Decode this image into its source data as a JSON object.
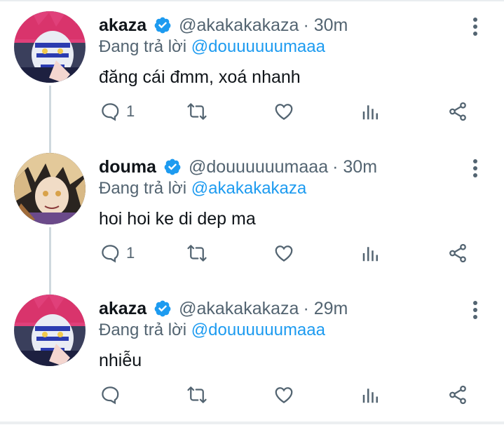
{
  "tweets": [
    {
      "name": "akaza",
      "handle": "@akakakakaza",
      "time": "· 30m",
      "reply_prefix": "Đang trả lời ",
      "reply_to": "@douuuuuumaaa",
      "text": "đăng cái đmm, xoá nhanh",
      "reply_count": "1",
      "avatar": "akaza-avatar"
    },
    {
      "name": "douma",
      "handle": "@douuuuuumaaa",
      "time": "· 30m",
      "reply_prefix": "Đang trả lời ",
      "reply_to": "@akakakakaza",
      "text": "hoi hoi ke di dep ma",
      "reply_count": "1",
      "avatar": "douma-avatar"
    },
    {
      "name": "akaza",
      "handle": "@akakakakaza",
      "time": "· 29m",
      "reply_prefix": "Đang trả lời ",
      "reply_to": "@douuuuuumaaa",
      "text": "nhiễu",
      "reply_count": "",
      "avatar": "akaza-avatar"
    }
  ],
  "colors": {
    "text": "#0f1419",
    "secondary": "#536471",
    "accent": "#1d9bf0",
    "thread_line": "#cfd9de"
  },
  "icons": [
    "verified-badge-icon",
    "more-options-icon",
    "reply-icon",
    "retweet-icon",
    "like-icon",
    "analytics-icon",
    "share-icon"
  ]
}
